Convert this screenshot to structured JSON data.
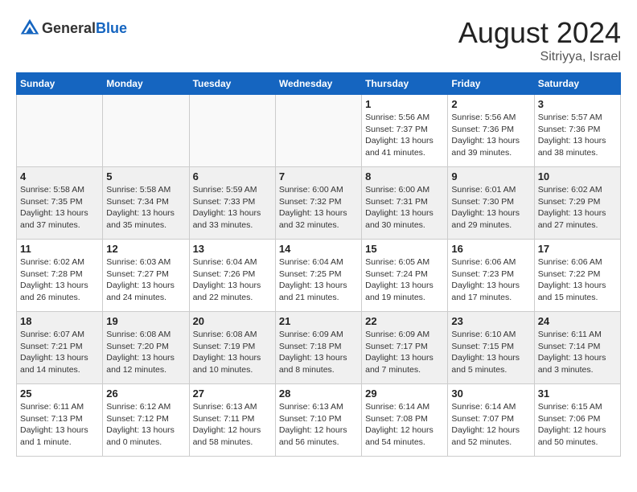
{
  "header": {
    "logo_general": "General",
    "logo_blue": "Blue",
    "month_year": "August 2024",
    "location": "Sitriyya, Israel"
  },
  "weekdays": [
    "Sunday",
    "Monday",
    "Tuesday",
    "Wednesday",
    "Thursday",
    "Friday",
    "Saturday"
  ],
  "weeks": [
    [
      {
        "day": "",
        "info": ""
      },
      {
        "day": "",
        "info": ""
      },
      {
        "day": "",
        "info": ""
      },
      {
        "day": "",
        "info": ""
      },
      {
        "day": "1",
        "sunrise": "5:56 AM",
        "sunset": "7:37 PM",
        "daylight": "13 hours and 41 minutes."
      },
      {
        "day": "2",
        "sunrise": "5:56 AM",
        "sunset": "7:36 PM",
        "daylight": "13 hours and 39 minutes."
      },
      {
        "day": "3",
        "sunrise": "5:57 AM",
        "sunset": "7:36 PM",
        "daylight": "13 hours and 38 minutes."
      }
    ],
    [
      {
        "day": "4",
        "sunrise": "5:58 AM",
        "sunset": "7:35 PM",
        "daylight": "13 hours and 37 minutes."
      },
      {
        "day": "5",
        "sunrise": "5:58 AM",
        "sunset": "7:34 PM",
        "daylight": "13 hours and 35 minutes."
      },
      {
        "day": "6",
        "sunrise": "5:59 AM",
        "sunset": "7:33 PM",
        "daylight": "13 hours and 33 minutes."
      },
      {
        "day": "7",
        "sunrise": "6:00 AM",
        "sunset": "7:32 PM",
        "daylight": "13 hours and 32 minutes."
      },
      {
        "day": "8",
        "sunrise": "6:00 AM",
        "sunset": "7:31 PM",
        "daylight": "13 hours and 30 minutes."
      },
      {
        "day": "9",
        "sunrise": "6:01 AM",
        "sunset": "7:30 PM",
        "daylight": "13 hours and 29 minutes."
      },
      {
        "day": "10",
        "sunrise": "6:02 AM",
        "sunset": "7:29 PM",
        "daylight": "13 hours and 27 minutes."
      }
    ],
    [
      {
        "day": "11",
        "sunrise": "6:02 AM",
        "sunset": "7:28 PM",
        "daylight": "13 hours and 26 minutes."
      },
      {
        "day": "12",
        "sunrise": "6:03 AM",
        "sunset": "7:27 PM",
        "daylight": "13 hours and 24 minutes."
      },
      {
        "day": "13",
        "sunrise": "6:04 AM",
        "sunset": "7:26 PM",
        "daylight": "13 hours and 22 minutes."
      },
      {
        "day": "14",
        "sunrise": "6:04 AM",
        "sunset": "7:25 PM",
        "daylight": "13 hours and 21 minutes."
      },
      {
        "day": "15",
        "sunrise": "6:05 AM",
        "sunset": "7:24 PM",
        "daylight": "13 hours and 19 minutes."
      },
      {
        "day": "16",
        "sunrise": "6:06 AM",
        "sunset": "7:23 PM",
        "daylight": "13 hours and 17 minutes."
      },
      {
        "day": "17",
        "sunrise": "6:06 AM",
        "sunset": "7:22 PM",
        "daylight": "13 hours and 15 minutes."
      }
    ],
    [
      {
        "day": "18",
        "sunrise": "6:07 AM",
        "sunset": "7:21 PM",
        "daylight": "13 hours and 14 minutes."
      },
      {
        "day": "19",
        "sunrise": "6:08 AM",
        "sunset": "7:20 PM",
        "daylight": "13 hours and 12 minutes."
      },
      {
        "day": "20",
        "sunrise": "6:08 AM",
        "sunset": "7:19 PM",
        "daylight": "13 hours and 10 minutes."
      },
      {
        "day": "21",
        "sunrise": "6:09 AM",
        "sunset": "7:18 PM",
        "daylight": "13 hours and 8 minutes."
      },
      {
        "day": "22",
        "sunrise": "6:09 AM",
        "sunset": "7:17 PM",
        "daylight": "13 hours and 7 minutes."
      },
      {
        "day": "23",
        "sunrise": "6:10 AM",
        "sunset": "7:15 PM",
        "daylight": "13 hours and 5 minutes."
      },
      {
        "day": "24",
        "sunrise": "6:11 AM",
        "sunset": "7:14 PM",
        "daylight": "13 hours and 3 minutes."
      }
    ],
    [
      {
        "day": "25",
        "sunrise": "6:11 AM",
        "sunset": "7:13 PM",
        "daylight": "13 hours and 1 minute."
      },
      {
        "day": "26",
        "sunrise": "6:12 AM",
        "sunset": "7:12 PM",
        "daylight": "13 hours and 0 minutes."
      },
      {
        "day": "27",
        "sunrise": "6:13 AM",
        "sunset": "7:11 PM",
        "daylight": "12 hours and 58 minutes."
      },
      {
        "day": "28",
        "sunrise": "6:13 AM",
        "sunset": "7:10 PM",
        "daylight": "12 hours and 56 minutes."
      },
      {
        "day": "29",
        "sunrise": "6:14 AM",
        "sunset": "7:08 PM",
        "daylight": "12 hours and 54 minutes."
      },
      {
        "day": "30",
        "sunrise": "6:14 AM",
        "sunset": "7:07 PM",
        "daylight": "12 hours and 52 minutes."
      },
      {
        "day": "31",
        "sunrise": "6:15 AM",
        "sunset": "7:06 PM",
        "daylight": "12 hours and 50 minutes."
      }
    ]
  ]
}
